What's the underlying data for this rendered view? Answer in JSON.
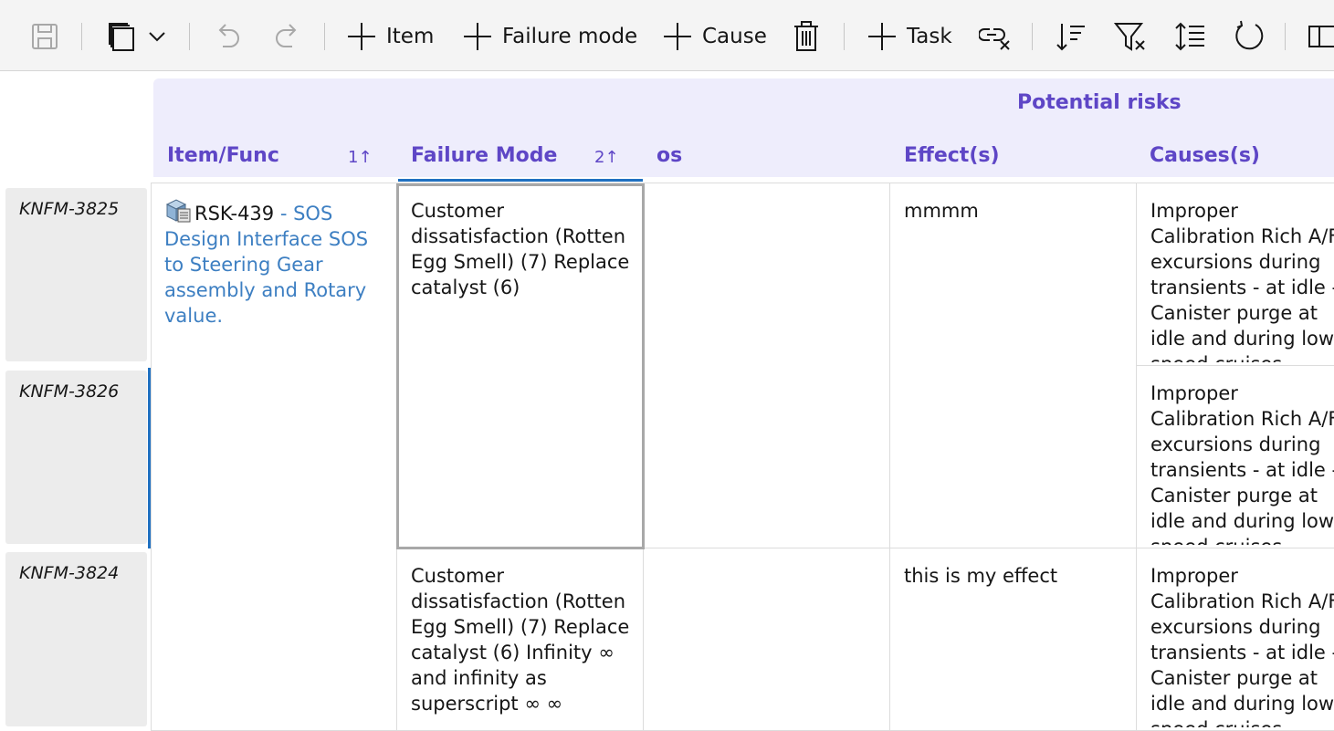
{
  "toolbar": {
    "add_item_label": "Item",
    "add_failure_mode_label": "Failure mode",
    "add_cause_label": "Cause",
    "add_task_label": "Task"
  },
  "header": {
    "group_label": "Potential risks",
    "columns": {
      "item_func": "Item/Func",
      "item_func_sort": "1↑",
      "failure_mode": "Failure Mode",
      "failure_mode_sort": "2↑",
      "os": "os",
      "effects": "Effect(s)",
      "causes": "Causes(s)"
    }
  },
  "rows": [
    {
      "id": "KNFM-3825"
    },
    {
      "id": "KNFM-3826"
    },
    {
      "id": "KNFM-3824"
    }
  ],
  "item": {
    "id": "RSK-439",
    "desc": " - SOS Design Interface SOS to Steering Gear assembly and Rotary value."
  },
  "failure_modes": [
    "Customer dissatisfaction (Rotten Egg Smell) (7) Replace catalyst (6)",
    "Customer dissatisfaction (Rotten Egg Smell) (7) Replace catalyst (6) Infinity ∞ and infinity as superscript ∞ ∞"
  ],
  "effects": [
    "mmmm",
    "this is my effect"
  ],
  "causes": [
    "Improper Calibration Rich A/F excursions during transients - at idle - Canister purge at idle and during low speed cruises",
    "Improper Calibration Rich A/F excursions during transients - at idle - Canister purge at idle and during low speed cruises",
    "Improper Calibration Rich A/F excursions during transients - at idle - Canister purge at idle and during low speed cruises"
  ],
  "colors": {
    "accent": "#1f70c1",
    "header_text": "#5e46c6",
    "header_bg": "#eeedfc",
    "link": "#3d7fc2"
  }
}
